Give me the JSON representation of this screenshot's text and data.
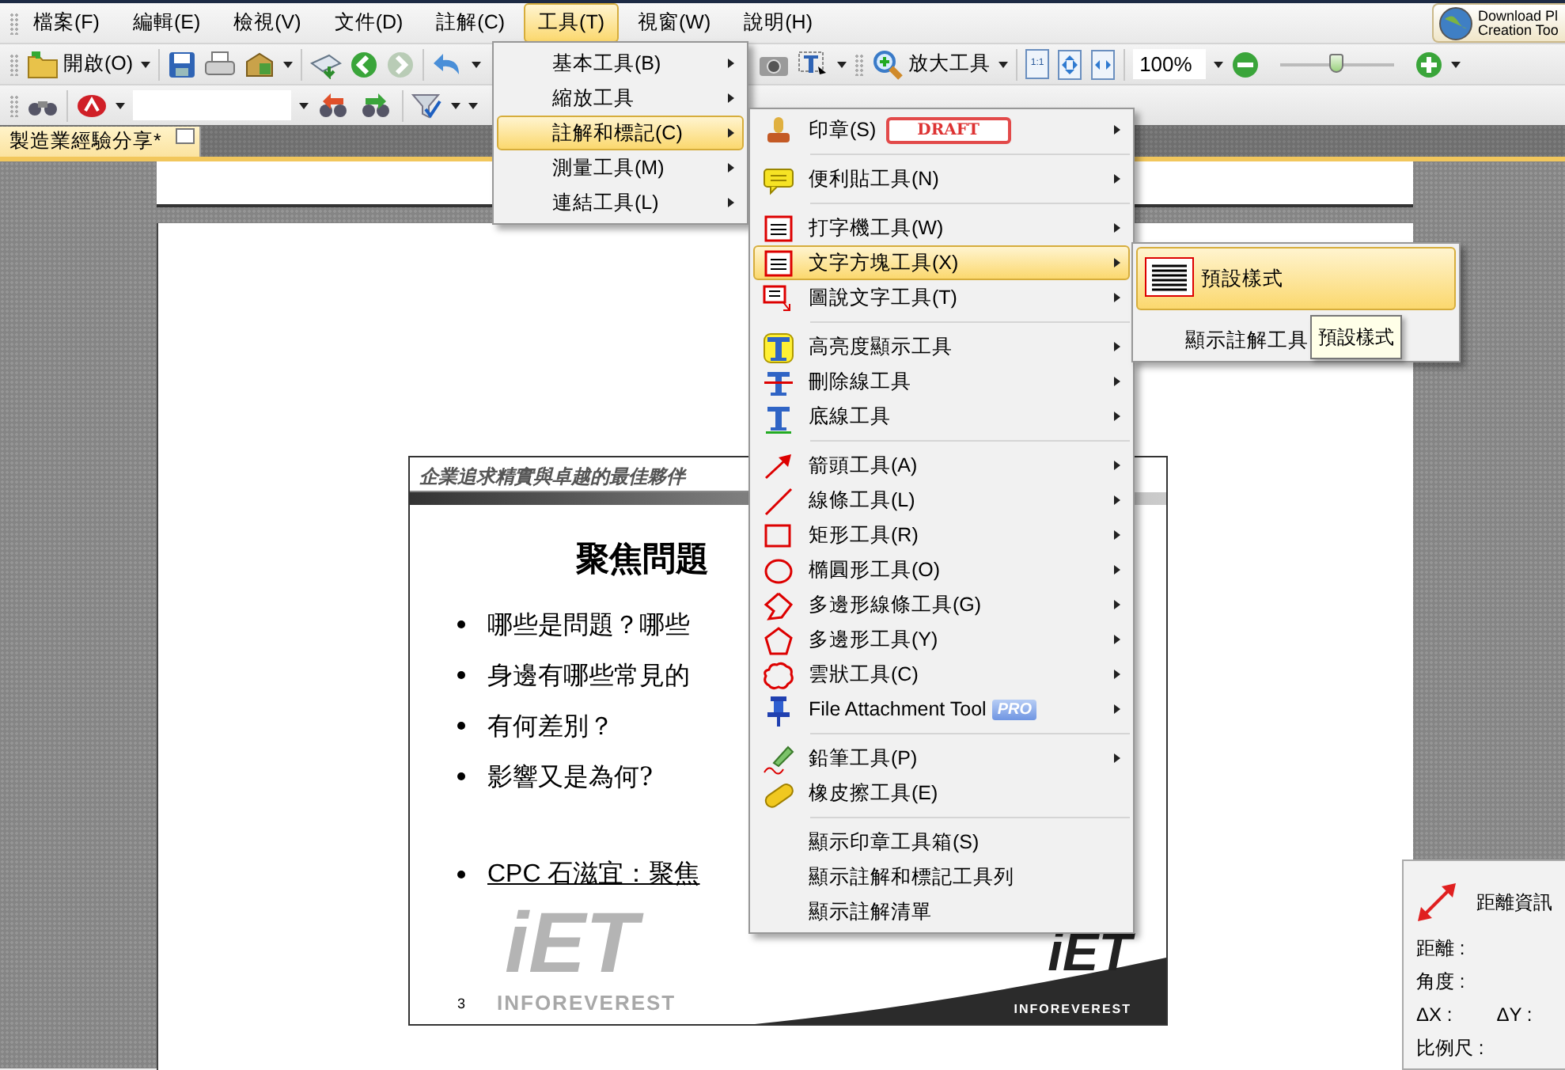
{
  "menubar": {
    "items": [
      {
        "label": "檔案(F)",
        "selected": false
      },
      {
        "label": "編輯(E)",
        "selected": false
      },
      {
        "label": "檢視(V)",
        "selected": false
      },
      {
        "label": "文件(D)",
        "selected": false
      },
      {
        "label": "註解(C)",
        "selected": false
      },
      {
        "label": "工具(T)",
        "selected": true
      },
      {
        "label": "視窗(W)",
        "selected": false
      },
      {
        "label": "說明(H)",
        "selected": false
      }
    ],
    "download_button": {
      "lines": [
        "Download Pl",
        "Creation Too"
      ]
    }
  },
  "main_toolbar": {
    "open_button": "開啟(O)",
    "zoom_tool": "放大工具",
    "actual_size": "1:1",
    "zoom_field": "100%",
    "zoom_slider": {
      "level": 0.48
    }
  },
  "document_tab": {
    "title": "製造業經驗分享*"
  },
  "slide": {
    "header": "企業追求精實與卓越的最佳夥伴",
    "title": "聚焦問題",
    "bullets": [
      "哪些是問題？哪些",
      "身邊有哪些常見的",
      "有何差別？",
      "影響又是為何?"
    ],
    "source": "CPC 石滋宜：聚焦",
    "page_number": "3",
    "watermark_logo": {
      "mark": "iET",
      "caption": "INFOREVEREST"
    },
    "corner_logo": {
      "mark": "iET",
      "caption": "INFOREVEREST"
    }
  },
  "tools_menu": {
    "items": [
      {
        "label": "基本工具(B)",
        "submenu": true,
        "selected": false
      },
      {
        "label": "縮放工具",
        "submenu": true,
        "selected": false
      },
      {
        "label": "註解和標記(C)",
        "submenu": true,
        "selected": true
      },
      {
        "label": "測量工具(M)",
        "submenu": true,
        "selected": false
      },
      {
        "label": "連結工具(L)",
        "submenu": true,
        "selected": false
      }
    ]
  },
  "annotation_menu": {
    "groups": [
      [
        {
          "kind": "tool",
          "label": "印章(S)",
          "stamp_preview": "DRAFT",
          "submenu": true,
          "selected": false
        }
      ],
      [
        {
          "kind": "tool",
          "label": "便利貼工具(N)",
          "submenu": true,
          "selected": false
        }
      ],
      [
        {
          "kind": "tool",
          "label": "打字機工具(W)",
          "submenu": true,
          "selected": false
        },
        {
          "kind": "tool",
          "label": "文字方塊工具(X)",
          "submenu": true,
          "selected": true
        },
        {
          "kind": "tool",
          "label": "圖說文字工具(T)",
          "submenu": true,
          "selected": false
        }
      ],
      [
        {
          "kind": "tool",
          "label": "高亮度顯示工具",
          "submenu": true,
          "selected": false
        },
        {
          "kind": "tool",
          "label": "刪除線工具",
          "submenu": true,
          "selected": false
        },
        {
          "kind": "tool",
          "label": "底線工具",
          "submenu": true,
          "selected": false
        }
      ],
      [
        {
          "kind": "tool",
          "label": "箭頭工具(A)",
          "submenu": true,
          "selected": false
        },
        {
          "kind": "tool",
          "label": "線條工具(L)",
          "submenu": true,
          "selected": false
        },
        {
          "kind": "tool",
          "label": "矩形工具(R)",
          "submenu": true,
          "selected": false
        },
        {
          "kind": "tool",
          "label": "橢圓形工具(O)",
          "submenu": true,
          "selected": false
        },
        {
          "kind": "tool",
          "label": "多邊形線條工具(G)",
          "submenu": true,
          "selected": false
        },
        {
          "kind": "tool",
          "label": "多邊形工具(Y)",
          "submenu": true,
          "selected": false
        },
        {
          "kind": "tool",
          "label": "雲狀工具(C)",
          "submenu": true,
          "selected": false
        },
        {
          "kind": "tool",
          "label": "File Attachment Tool",
          "badge": "PRO",
          "submenu": true,
          "selected": false
        }
      ],
      [
        {
          "kind": "tool",
          "label": "鉛筆工具(P)",
          "submenu": true,
          "selected": false
        },
        {
          "kind": "tool",
          "label": "橡皮擦工具(E)",
          "submenu": false,
          "selected": false
        }
      ],
      [
        {
          "kind": "command",
          "label": "顯示印章工具箱(S)",
          "submenu": false,
          "selected": false
        },
        {
          "kind": "command",
          "label": "顯示註解和標記工具列",
          "submenu": false,
          "selected": false
        },
        {
          "kind": "command",
          "label": "顯示註解清單",
          "submenu": false,
          "selected": false
        }
      ]
    ]
  },
  "textbox_submenu": {
    "items": [
      {
        "kind": "style",
        "label": "預設樣式",
        "selected": true
      },
      {
        "kind": "command",
        "label": "顯示註解工具",
        "selected": false
      }
    ],
    "tooltip": "預設樣式"
  },
  "distance_panel": {
    "title": "距離資訊",
    "rows": [
      [
        "距離 :"
      ],
      [
        "角度 :"
      ],
      [
        "ΔX :",
        "ΔY :"
      ],
      [
        "比例尺 :"
      ]
    ]
  }
}
